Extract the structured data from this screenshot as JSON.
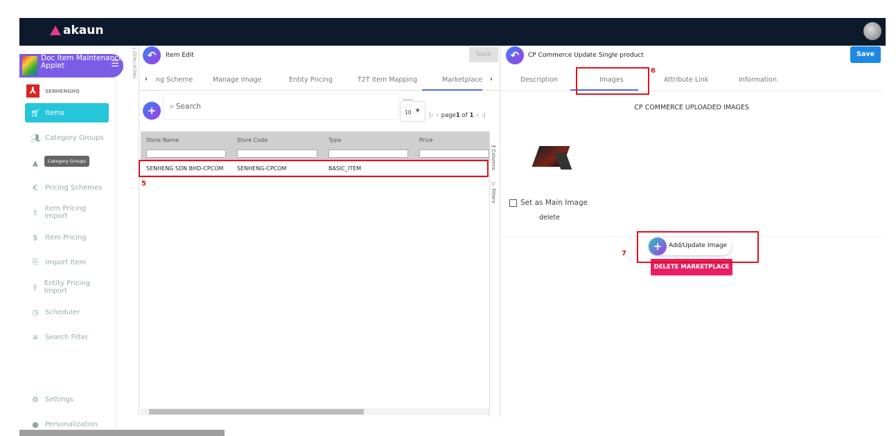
{
  "topbar": {
    "brand": "akaun"
  },
  "applet": {
    "title": "Doc Item Maintenance Applet",
    "company": "SENHENGHQ"
  },
  "sidebar": {
    "items": [
      {
        "label": "Items",
        "icon": "cart-icon",
        "active": true
      },
      {
        "label": "Category Groups",
        "icon": "group-icon"
      },
      {
        "label": "",
        "icon": "shapes-icon"
      },
      {
        "label": "Pricing Schemes",
        "icon": "euro-icon"
      },
      {
        "label": "Item Pricing Import",
        "icon": "upload-icon"
      },
      {
        "label": "Item Pricing",
        "icon": "dollar-icon"
      },
      {
        "label": "Import Item",
        "icon": "file-import-icon"
      },
      {
        "label": "Entity Pricing Import",
        "icon": "upload-icon"
      },
      {
        "label": "Scheduler",
        "icon": "clock-icon"
      },
      {
        "label": "Search Filter",
        "icon": "search-filter-icon"
      }
    ],
    "tooltip": "Category Groups",
    "settings": "Settings",
    "personalization": "Personalization"
  },
  "vertical_label": {
    "number": "1",
    "text": "ITEM LISTING"
  },
  "left": {
    "title": "Item Edit",
    "save": "Save",
    "tabs": [
      "ng Scheme",
      "Manage Image",
      "Entity Pricing",
      "T2T Item Mapping",
      "Marketplace"
    ],
    "search_placeholder": "Search",
    "rows_label": "Rows",
    "rows_value": "10",
    "pager": {
      "prefix": "page",
      "page": "1",
      "of": "of",
      "total": "1"
    },
    "columns": [
      "Store Name",
      "Store Code",
      "Type",
      "Price"
    ],
    "rows": [
      [
        "SENHENG SDN BHD-CPCOM",
        "SENHENG-CPCOM",
        "BASIC_ITEM",
        ""
      ]
    ],
    "side_tabs": [
      "Columns",
      "Filters"
    ],
    "annotation": "5"
  },
  "right": {
    "title": "CP Commerce Update Single product",
    "save": "Save",
    "tabs": [
      "Description",
      "Images",
      "Attribute Link",
      "Information"
    ],
    "active_tab": "Images",
    "heading": "CP COMMERCE UPLOADED IMAGES",
    "set_main": "Set as Main Image",
    "delete": "delete",
    "add_update": "Add/Update Image",
    "delete_marketplace": "DELETE MARKETPLACE",
    "annotations": [
      "6",
      "7"
    ]
  },
  "colors": {
    "topbar": "#0c1a2c",
    "applet": "#7b5ce6",
    "active_nav": "#26c6da",
    "save": "#1e88e5",
    "delete": "#e91e63",
    "annotation": "#e0111b"
  }
}
